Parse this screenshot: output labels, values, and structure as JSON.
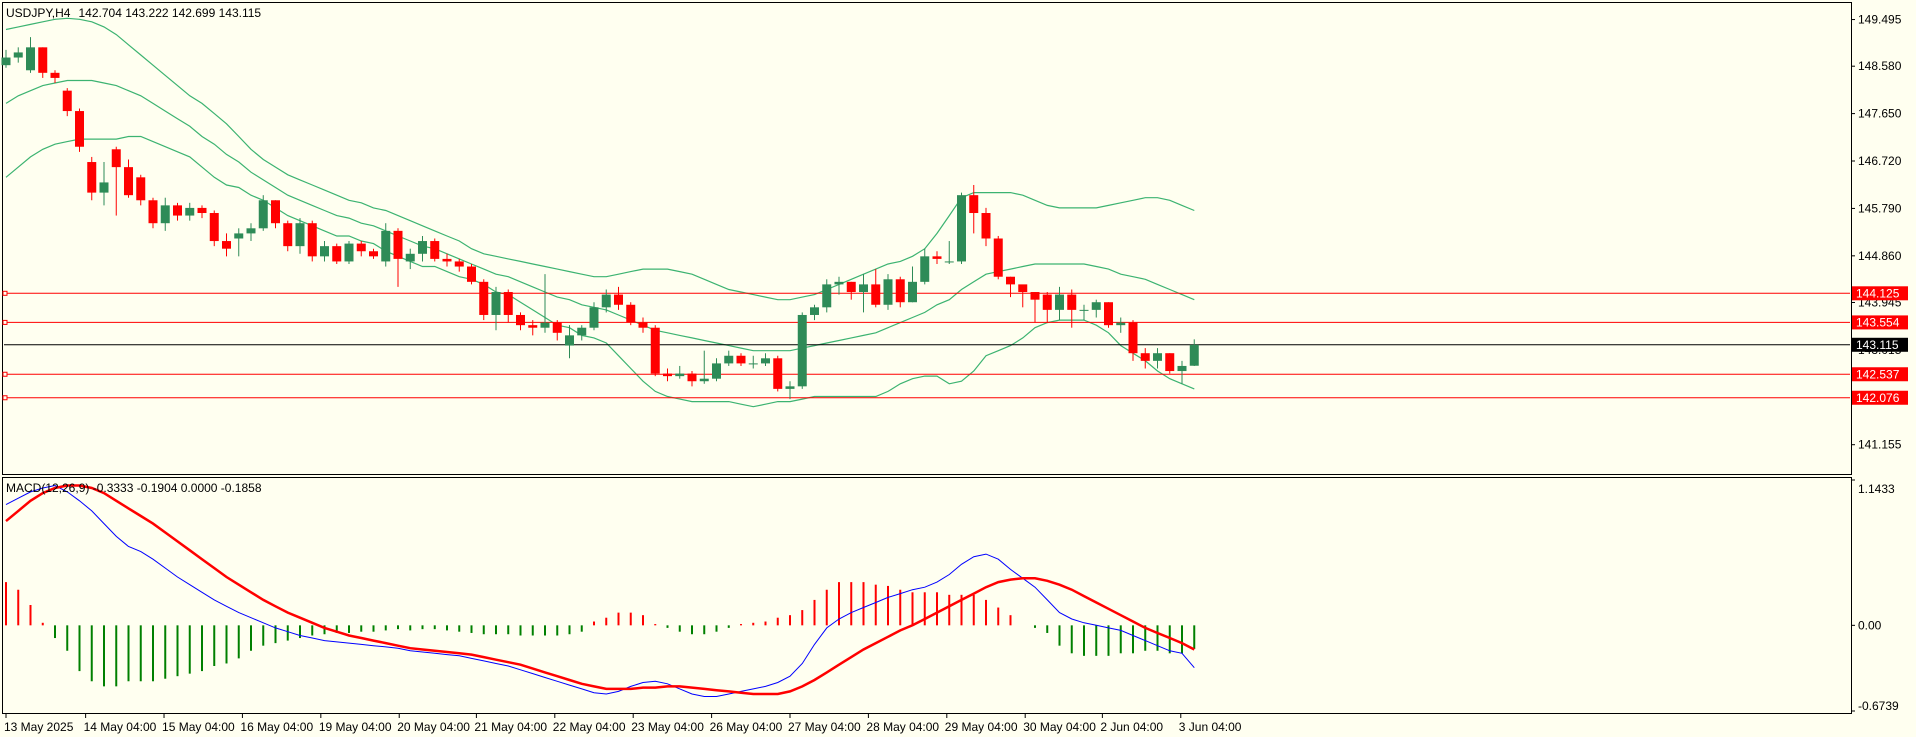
{
  "chart_data": [
    {
      "type": "candlestick",
      "symbol_label": "USDJPY,H4",
      "ohlc_label": "142.704 143.222 142.699 143.115",
      "y_range": [
        140.6,
        149.8
      ],
      "y_ticks": [
        149.495,
        148.58,
        147.65,
        146.72,
        145.79,
        144.86,
        143.945,
        143.015,
        141.155
      ],
      "y_tick_labels": [
        "149.495",
        "148.580",
        "147.650",
        "146.720",
        "145.790",
        "144.860",
        "143.945",
        "143.015",
        "141.155"
      ],
      "x_ticks": [
        {
          "index": 0,
          "label": "13 May 2025"
        },
        {
          "index": 6.5,
          "label": "14 May 04:00"
        },
        {
          "index": 12.9,
          "label": "15 May 04:00"
        },
        {
          "index": 19.3,
          "label": "16 May 04:00"
        },
        {
          "index": 25.7,
          "label": "19 May 04:00"
        },
        {
          "index": 32.1,
          "label": "20 May 04:00"
        },
        {
          "index": 38.4,
          "label": "21 May 04:00"
        },
        {
          "index": 44.8,
          "label": "22 May 04:00"
        },
        {
          "index": 51.2,
          "label": "23 May 04:00"
        },
        {
          "index": 57.6,
          "label": "26 May 04:00"
        },
        {
          "index": 64.0,
          "label": "27 May 04:00"
        },
        {
          "index": 70.4,
          "label": "28 May 04:00"
        },
        {
          "index": 76.8,
          "label": "29 May 04:00"
        },
        {
          "index": 83.2,
          "label": "30 May 04:00"
        },
        {
          "index": 89.5,
          "label": "2 Jun 04:00"
        },
        {
          "index": 95.9,
          "label": "3 Jun 04:00"
        }
      ],
      "levels": [
        {
          "value": 144.125,
          "label": "144.125",
          "color": "#ff0000"
        },
        {
          "value": 143.554,
          "label": "143.554",
          "color": "#ff0000"
        },
        {
          "value": 142.537,
          "label": "142.537",
          "color": "#ff0000"
        },
        {
          "value": 142.076,
          "label": "142.076",
          "color": "#ff0000"
        }
      ],
      "current_price": {
        "value": 143.115,
        "label": "143.115",
        "color": "#000000"
      },
      "colors": {
        "bull": "#2e8b57",
        "bear": "#ff0000",
        "band": "#3cb371",
        "background": "#fffff0"
      },
      "close": [
        148.75,
        148.85,
        148.95,
        148.45,
        148.35,
        147.7,
        147.0,
        146.1,
        146.3,
        146.6,
        146.05,
        145.95,
        145.5,
        145.85,
        145.65,
        145.8,
        145.7,
        145.15,
        145.0,
        145.3,
        145.4,
        145.95,
        145.5,
        145.05,
        145.5,
        144.85,
        145.05,
        144.75,
        145.1,
        144.95,
        144.85,
        145.35,
        144.8,
        144.9,
        145.15,
        144.8,
        144.75,
        144.65,
        144.35,
        143.7,
        144.15,
        143.7,
        143.5,
        143.45,
        143.55,
        143.35,
        143.3,
        143.45,
        143.85,
        144.1,
        143.9,
        143.55,
        143.45,
        142.55,
        142.5,
        142.55,
        142.4,
        142.45,
        142.75,
        142.9,
        142.75,
        142.75,
        142.85,
        142.25,
        142.3,
        143.7,
        143.85,
        144.3,
        144.35,
        144.15,
        144.3,
        143.9,
        144.4,
        143.95,
        144.35,
        144.85,
        144.8,
        144.75,
        146.05,
        145.7,
        145.2,
        144.45,
        144.3,
        144.15,
        144.0,
        143.8,
        144.1,
        143.8,
        143.8,
        143.95,
        143.5,
        143.55,
        142.95,
        142.8,
        142.95,
        142.6,
        142.7,
        143.115
      ],
      "open": [
        148.6,
        148.75,
        148.5,
        148.95,
        148.45,
        148.1,
        147.7,
        146.7,
        146.1,
        146.95,
        146.6,
        146.4,
        145.95,
        145.5,
        145.85,
        145.65,
        145.8,
        145.7,
        145.15,
        145.2,
        145.3,
        145.4,
        145.95,
        145.5,
        145.05,
        145.5,
        144.85,
        145.05,
        144.75,
        145.1,
        144.95,
        144.75,
        145.35,
        144.75,
        144.9,
        145.15,
        144.8,
        144.75,
        144.65,
        144.35,
        143.7,
        144.15,
        143.7,
        143.5,
        143.45,
        143.55,
        143.1,
        143.3,
        143.45,
        143.85,
        144.1,
        143.9,
        143.55,
        143.45,
        142.55,
        142.5,
        142.55,
        142.4,
        142.45,
        142.75,
        142.9,
        142.75,
        142.75,
        142.85,
        142.25,
        142.3,
        143.7,
        143.85,
        144.3,
        144.35,
        144.15,
        144.3,
        143.9,
        144.4,
        143.95,
        144.35,
        144.85,
        144.75,
        144.75,
        146.05,
        145.7,
        145.2,
        144.45,
        144.3,
        144.15,
        144.1,
        143.8,
        144.1,
        143.8,
        143.8,
        143.95,
        143.5,
        143.55,
        142.95,
        142.8,
        142.95,
        142.6,
        142.704
      ],
      "high": [
        148.9,
        148.95,
        149.15,
        148.95,
        148.5,
        148.15,
        147.75,
        146.8,
        146.7,
        147.0,
        146.75,
        146.45,
        146.0,
        146.0,
        145.9,
        145.9,
        145.85,
        145.75,
        145.3,
        145.4,
        145.5,
        146.05,
        145.95,
        145.55,
        145.6,
        145.55,
        145.15,
        145.1,
        145.15,
        145.15,
        145.0,
        145.5,
        145.4,
        145.0,
        145.25,
        145.2,
        144.9,
        144.8,
        144.7,
        144.4,
        144.25,
        144.2,
        143.75,
        143.6,
        144.5,
        143.6,
        143.5,
        143.5,
        143.95,
        144.2,
        144.25,
        143.95,
        143.65,
        143.5,
        142.65,
        142.7,
        142.6,
        143.0,
        142.85,
        143.0,
        142.95,
        142.9,
        142.95,
        142.9,
        142.4,
        143.75,
        143.9,
        144.4,
        144.45,
        144.35,
        144.5,
        144.6,
        144.5,
        144.45,
        144.65,
        145.0,
        144.95,
        145.15,
        146.1,
        146.25,
        145.8,
        145.25,
        144.45,
        144.25,
        144.15,
        144.15,
        144.25,
        144.2,
        143.9,
        144.0,
        143.95,
        143.65,
        143.6,
        143.05,
        143.05,
        142.95,
        142.8,
        143.222
      ],
      "low": [
        148.55,
        148.65,
        148.45,
        148.35,
        148.25,
        147.6,
        146.9,
        145.95,
        145.85,
        145.65,
        146.0,
        145.85,
        145.4,
        145.35,
        145.55,
        145.55,
        145.6,
        145.05,
        144.85,
        144.85,
        145.15,
        145.35,
        145.4,
        144.95,
        144.9,
        144.75,
        144.75,
        144.7,
        144.7,
        144.85,
        144.8,
        144.65,
        144.25,
        144.6,
        144.75,
        144.75,
        144.65,
        144.55,
        144.3,
        143.6,
        143.4,
        143.55,
        143.4,
        143.3,
        143.35,
        143.2,
        142.85,
        143.2,
        143.4,
        143.75,
        143.8,
        143.5,
        143.35,
        142.5,
        142.4,
        142.45,
        142.3,
        142.35,
        142.4,
        142.7,
        142.7,
        142.65,
        142.7,
        142.2,
        142.05,
        142.25,
        143.6,
        143.75,
        144.1,
        144.0,
        143.75,
        143.85,
        143.8,
        143.85,
        143.95,
        144.3,
        144.7,
        144.7,
        144.7,
        145.3,
        145.05,
        144.4,
        144.05,
        143.85,
        143.55,
        143.55,
        143.6,
        143.45,
        143.6,
        143.65,
        143.45,
        143.35,
        142.8,
        142.65,
        142.65,
        142.55,
        142.35,
        142.699
      ],
      "bollinger": {
        "upper": [
          149.3,
          149.35,
          149.4,
          149.45,
          149.5,
          149.52,
          149.5,
          149.45,
          149.35,
          149.2,
          149.0,
          148.8,
          148.6,
          148.4,
          148.2,
          148.0,
          147.85,
          147.65,
          147.45,
          147.2,
          146.95,
          146.75,
          146.6,
          146.45,
          146.35,
          146.25,
          146.15,
          146.05,
          145.95,
          145.9,
          145.8,
          145.75,
          145.65,
          145.55,
          145.45,
          145.35,
          145.25,
          145.15,
          145.0,
          144.9,
          144.85,
          144.8,
          144.75,
          144.7,
          144.65,
          144.6,
          144.55,
          144.5,
          144.45,
          144.45,
          144.5,
          144.55,
          144.6,
          144.6,
          144.6,
          144.55,
          144.5,
          144.4,
          144.3,
          144.2,
          144.15,
          144.1,
          144.05,
          144.0,
          144.0,
          144.05,
          144.1,
          144.2,
          144.3,
          144.4,
          144.5,
          144.6,
          144.7,
          144.75,
          144.85,
          145.0,
          145.3,
          145.65,
          146.0,
          146.1,
          146.1,
          146.1,
          146.1,
          146.05,
          145.95,
          145.85,
          145.8,
          145.8,
          145.8,
          145.8,
          145.85,
          145.9,
          145.95,
          146.0,
          146.0,
          145.95,
          145.85,
          145.75
        ],
        "middle": [
          147.85,
          148.0,
          148.1,
          148.2,
          148.25,
          148.3,
          148.3,
          148.3,
          148.25,
          148.2,
          148.1,
          148.0,
          147.85,
          147.7,
          147.55,
          147.4,
          147.2,
          147.05,
          146.85,
          146.7,
          146.5,
          146.35,
          146.2,
          146.05,
          145.95,
          145.85,
          145.75,
          145.65,
          145.6,
          145.5,
          145.45,
          145.35,
          145.25,
          145.15,
          145.05,
          145.0,
          144.9,
          144.8,
          144.7,
          144.6,
          144.5,
          144.45,
          144.35,
          144.25,
          144.15,
          144.05,
          144.0,
          143.9,
          143.85,
          143.8,
          143.7,
          143.6,
          143.5,
          143.4,
          143.35,
          143.3,
          143.25,
          143.2,
          143.15,
          143.1,
          143.05,
          143.0,
          143.0,
          143.0,
          143.0,
          143.05,
          143.1,
          143.15,
          143.2,
          143.25,
          143.3,
          143.35,
          143.45,
          143.55,
          143.65,
          143.75,
          143.9,
          144.0,
          144.2,
          144.35,
          144.5,
          144.55,
          144.6,
          144.65,
          144.7,
          144.7,
          144.7,
          144.7,
          144.7,
          144.65,
          144.6,
          144.5,
          144.45,
          144.4,
          144.3,
          144.2,
          144.1,
          144.0
        ],
        "lower": [
          146.4,
          146.6,
          146.8,
          146.95,
          147.05,
          147.1,
          147.15,
          147.15,
          147.15,
          147.15,
          147.2,
          147.2,
          147.1,
          147.0,
          146.9,
          146.8,
          146.6,
          146.4,
          146.25,
          146.2,
          146.05,
          145.95,
          145.8,
          145.65,
          145.55,
          145.45,
          145.35,
          145.25,
          145.25,
          145.15,
          145.1,
          144.95,
          144.85,
          144.75,
          144.65,
          144.65,
          144.55,
          144.45,
          144.4,
          144.3,
          144.15,
          144.1,
          143.95,
          143.8,
          143.65,
          143.5,
          143.45,
          143.3,
          143.25,
          143.15,
          142.9,
          142.65,
          142.4,
          142.2,
          142.1,
          142.05,
          142.0,
          142.0,
          142.0,
          142.0,
          141.95,
          141.9,
          141.95,
          142.0,
          142.0,
          142.05,
          142.1,
          142.1,
          142.1,
          142.1,
          142.1,
          142.1,
          142.2,
          142.35,
          142.45,
          142.5,
          142.5,
          142.35,
          142.4,
          142.6,
          142.9,
          143.0,
          143.1,
          143.25,
          143.45,
          143.55,
          143.6,
          143.6,
          143.6,
          143.5,
          143.35,
          143.1,
          142.95,
          142.8,
          142.6,
          142.45,
          142.35,
          142.25
        ]
      }
    },
    {
      "type": "macd",
      "label": "MACD(12,26,9) -0.3333 -0.1904 0.0000 -0.1858",
      "y_range": [
        -0.6739,
        1.1433
      ],
      "y_ticks": [
        1.1433,
        0.0,
        -0.6739
      ],
      "y_tick_labels": [
        "1.1433",
        "0.00",
        "-0.6739"
      ],
      "colors": {
        "hist_up": "#ff0000",
        "hist_down": "#008000",
        "macd": "#0000ff",
        "signal": "#ff0000"
      },
      "macd": [
        0.95,
        1.0,
        1.05,
        1.08,
        1.1,
        1.05,
        0.98,
        0.9,
        0.8,
        0.7,
        0.62,
        0.58,
        0.52,
        0.45,
        0.38,
        0.32,
        0.26,
        0.2,
        0.15,
        0.1,
        0.06,
        0.02,
        -0.02,
        -0.05,
        -0.08,
        -0.1,
        -0.12,
        -0.13,
        -0.14,
        -0.15,
        -0.16,
        -0.17,
        -0.18,
        -0.2,
        -0.21,
        -0.22,
        -0.23,
        -0.24,
        -0.26,
        -0.28,
        -0.3,
        -0.32,
        -0.35,
        -0.38,
        -0.41,
        -0.44,
        -0.47,
        -0.5,
        -0.53,
        -0.54,
        -0.52,
        -0.48,
        -0.45,
        -0.44,
        -0.46,
        -0.5,
        -0.54,
        -0.56,
        -0.56,
        -0.54,
        -0.52,
        -0.5,
        -0.48,
        -0.45,
        -0.4,
        -0.3,
        -0.15,
        -0.02,
        0.05,
        0.1,
        0.14,
        0.18,
        0.22,
        0.25,
        0.28,
        0.3,
        0.34,
        0.4,
        0.48,
        0.54,
        0.56,
        0.52,
        0.44,
        0.37,
        0.3,
        0.2,
        0.1,
        0.05,
        0.02,
        0.0,
        -0.02,
        -0.04,
        -0.08,
        -0.12,
        -0.16,
        -0.2,
        -0.22,
        -0.3333
      ],
      "signal": [
        0.82,
        0.9,
        0.98,
        1.04,
        1.08,
        1.1,
        1.1,
        1.08,
        1.04,
        0.98,
        0.92,
        0.86,
        0.8,
        0.73,
        0.66,
        0.59,
        0.52,
        0.45,
        0.38,
        0.32,
        0.26,
        0.2,
        0.15,
        0.1,
        0.06,
        0.02,
        -0.02,
        -0.05,
        -0.08,
        -0.1,
        -0.12,
        -0.14,
        -0.16,
        -0.18,
        -0.19,
        -0.2,
        -0.21,
        -0.22,
        -0.23,
        -0.25,
        -0.27,
        -0.29,
        -0.31,
        -0.34,
        -0.37,
        -0.4,
        -0.43,
        -0.46,
        -0.48,
        -0.5,
        -0.5,
        -0.5,
        -0.49,
        -0.49,
        -0.48,
        -0.48,
        -0.49,
        -0.5,
        -0.51,
        -0.52,
        -0.53,
        -0.54,
        -0.54,
        -0.54,
        -0.52,
        -0.48,
        -0.43,
        -0.37,
        -0.31,
        -0.25,
        -0.19,
        -0.14,
        -0.09,
        -0.04,
        0.0,
        0.05,
        0.1,
        0.15,
        0.2,
        0.25,
        0.3,
        0.34,
        0.36,
        0.37,
        0.37,
        0.35,
        0.32,
        0.28,
        0.23,
        0.18,
        0.13,
        0.08,
        0.03,
        -0.02,
        -0.06,
        -0.1,
        -0.14,
        -0.1904
      ],
      "histogram": [
        0.34,
        0.28,
        0.16,
        0.02,
        -0.1,
        -0.2,
        -0.36,
        -0.44,
        -0.48,
        -0.48,
        -0.44,
        -0.44,
        -0.44,
        -0.42,
        -0.4,
        -0.38,
        -0.36,
        -0.32,
        -0.3,
        -0.26,
        -0.2,
        -0.16,
        -0.14,
        -0.12,
        -0.1,
        -0.08,
        -0.07,
        -0.06,
        -0.06,
        -0.05,
        -0.05,
        -0.04,
        -0.03,
        -0.04,
        -0.03,
        -0.03,
        -0.04,
        -0.05,
        -0.06,
        -0.07,
        -0.07,
        -0.07,
        -0.08,
        -0.08,
        -0.08,
        -0.08,
        -0.07,
        -0.05,
        0.03,
        0.06,
        0.1,
        0.1,
        0.08,
        0.01,
        -0.02,
        -0.05,
        -0.07,
        -0.07,
        -0.05,
        -0.02,
        0.01,
        0.02,
        0.03,
        0.06,
        0.08,
        0.12,
        0.2,
        0.28,
        0.34,
        0.34,
        0.34,
        0.32,
        0.31,
        0.28,
        0.26,
        0.26,
        0.26,
        0.24,
        0.24,
        0.24,
        0.2,
        0.14,
        0.08,
        0.0,
        -0.02,
        -0.06,
        -0.16,
        -0.22,
        -0.24,
        -0.24,
        -0.24,
        -0.22,
        -0.22,
        -0.2,
        -0.2,
        -0.22,
        -0.22,
        -0.1858
      ]
    }
  ]
}
